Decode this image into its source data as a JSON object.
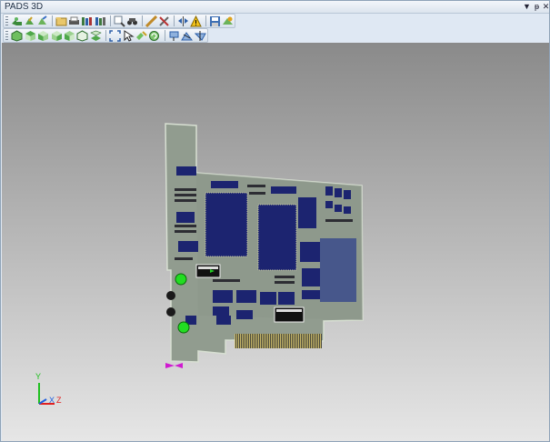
{
  "window": {
    "title": "PADS 3D"
  },
  "title_controls": {
    "dropdown": "▼",
    "pin": "ᵽ",
    "close": "✕"
  },
  "toolbar1": {
    "buttons": [
      "open-icon",
      "import-icon",
      "export-icon",
      "folder-icon",
      "print-icon",
      "library-icon",
      "library-edit-icon",
      "zoom-icon",
      "binoculars-icon",
      "measure-icon",
      "tools-icon",
      "flip-icon",
      "warning-icon",
      "save-view-icon",
      "settings-icon"
    ]
  },
  "toolbar2": {
    "buttons": [
      "view-iso-icon",
      "view-top-icon",
      "view-front-icon",
      "view-right-icon",
      "view-left-icon",
      "view-back-icon",
      "view-bottom-icon",
      "fit-icon",
      "select-icon",
      "pan-icon",
      "rotate-icon",
      "clip-x-icon",
      "clip-y-icon",
      "clip-z-icon"
    ]
  },
  "axis": {
    "x": "X",
    "y": "Y",
    "z": "Z"
  },
  "colors": {
    "board": "#8f9a8d",
    "chip": "#1c2470",
    "led": "#22dd22",
    "x_axis": "#e02020",
    "y_axis": "#20c020",
    "z_axis": "#2060e0"
  }
}
